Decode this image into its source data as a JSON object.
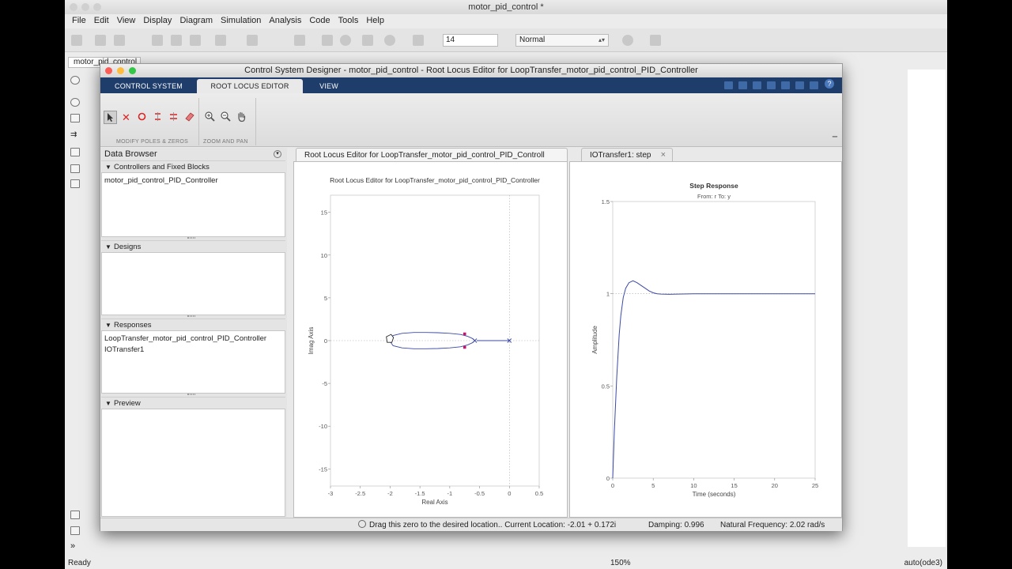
{
  "sim": {
    "title": "motor_pid_control *",
    "menu": [
      "File",
      "Edit",
      "View",
      "Display",
      "Diagram",
      "Simulation",
      "Analysis",
      "Code",
      "Tools",
      "Help"
    ],
    "stop_time": "14",
    "sim_mode": "Normal",
    "model_tab": "motor_pid_control",
    "status": {
      "state": "Ready",
      "zoom": "150%",
      "solver": "auto(ode3)"
    }
  },
  "csd": {
    "title": "Control System Designer - motor_pid_control - Root Locus Editor for LoopTransfer_motor_pid_control_PID_Controller",
    "tabs": [
      "CONTROL SYSTEM",
      "ROOT LOCUS EDITOR",
      "VIEW"
    ],
    "ribbon_sections": [
      "MODIFY POLES & ZEROS",
      "ZOOM AND PAN"
    ],
    "data_browser": {
      "title": "Data Browser",
      "sections": [
        {
          "label": "Controllers and Fixed Blocks",
          "items": [
            "motor_pid_control_PID_Controller"
          ]
        },
        {
          "label": "Designs",
          "items": []
        },
        {
          "label": "Responses",
          "items": [
            "LoopTransfer_motor_pid_control_PID_Controller",
            "IOTransfer1"
          ]
        },
        {
          "label": "Preview",
          "items": []
        }
      ]
    },
    "doc_tabs": [
      "Root Locus Editor for LoopTransfer_motor_pid_control_PID_Controll",
      "IOTransfer1: step"
    ],
    "status": {
      "message": "Drag this zero to the desired location.. Current Location: -2.01 + 0.172i",
      "damping": "Damping: 0.996",
      "frequency": "Natural Frequency: 2.02 rad/s"
    },
    "colors": {
      "ribbon_blue": "#1e3d6b",
      "locus": "#3b4aa6",
      "pole_marker": "#c0186e"
    }
  },
  "chart_data": [
    {
      "type": "scatter",
      "title": "Root Locus Editor for LoopTransfer_motor_pid_control_PID_Controller",
      "xlabel": "Real Axis",
      "ylabel": "Imag Axis",
      "xlim": [
        -3,
        0.5
      ],
      "ylim": [
        -17,
        17
      ],
      "xticks": [
        -3,
        -2.5,
        -2,
        -1.5,
        -1,
        -0.5,
        0,
        0.5
      ],
      "yticks": [
        -15,
        -10,
        -5,
        0,
        5,
        10,
        15
      ],
      "grid": true,
      "locus_branch": {
        "x": [
          -2.01,
          -1.95,
          -1.8,
          -1.6,
          -1.4,
          -1.2,
          -1.0,
          -0.82,
          -0.7,
          -0.62,
          -0.58
        ],
        "y": [
          0,
          0.6,
          0.85,
          0.95,
          0.95,
          0.92,
          0.85,
          0.72,
          0.5,
          0.25,
          0
        ]
      },
      "real_axis_locus": {
        "x": [
          -0.55,
          0
        ]
      },
      "poles": [
        {
          "x": -0.58,
          "y": 0
        },
        {
          "x": 0,
          "y": 0
        }
      ],
      "closed_loop_poles": [
        {
          "x": -0.75,
          "y": 0.78
        },
        {
          "x": -0.75,
          "y": -0.78
        }
      ],
      "zeros": [
        {
          "x": -2.01,
          "y": 0.172
        }
      ]
    },
    {
      "type": "line",
      "title": "Step Response",
      "subtitle": "From: r  To: y",
      "xlabel": "Time (seconds)",
      "ylabel": "Amplitude",
      "xlim": [
        0,
        25
      ],
      "ylim": [
        0,
        1.5
      ],
      "xticks": [
        0,
        5,
        10,
        15,
        20,
        25
      ],
      "yticks": [
        0,
        0.5,
        1,
        1.5
      ],
      "series": [
        {
          "x": [
            0,
            0.2,
            0.5,
            0.8,
            1.0,
            1.3,
            1.6,
            2.0,
            2.5,
            3.0,
            3.5,
            4.0,
            4.5,
            5.0,
            5.5,
            6.0,
            7.0,
            8.0,
            10.0,
            15.0,
            20.0,
            25.0
          ],
          "y": [
            0,
            0.25,
            0.55,
            0.78,
            0.88,
            0.98,
            1.03,
            1.06,
            1.07,
            1.06,
            1.045,
            1.03,
            1.015,
            1.005,
            1.0,
            0.998,
            0.997,
            0.998,
            1.0,
            1.0,
            1.0,
            1.0
          ]
        }
      ]
    }
  ]
}
